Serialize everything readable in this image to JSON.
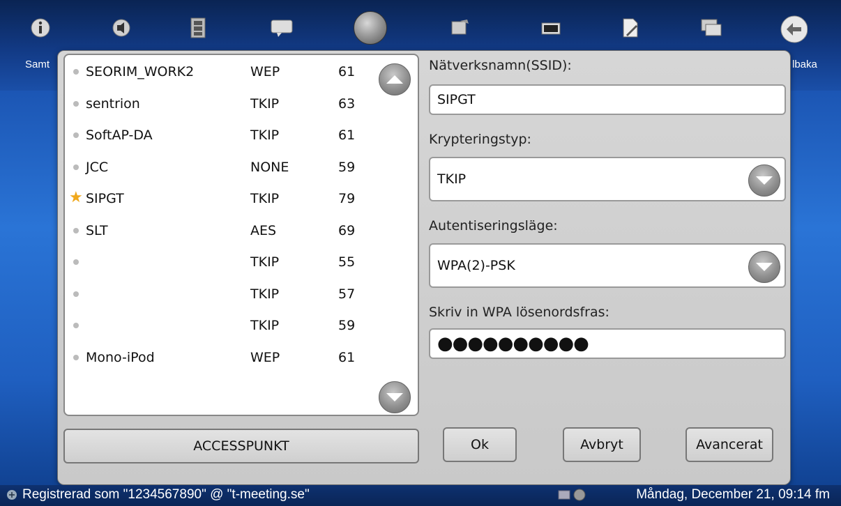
{
  "topbar": {
    "left_label": "Samt",
    "right_label": "lbaka",
    "icons": [
      "info-icon",
      "audio-icon",
      "film-icon",
      "chat-icon",
      "globe-icon",
      "photo-icon",
      "folder-icon",
      "document-icon",
      "windows-icon",
      "back-icon"
    ]
  },
  "network_list": {
    "rows": [
      {
        "name": "SEORIM_WORK2",
        "encryption": "WEP",
        "signal": "61",
        "selected": false
      },
      {
        "name": "sentrion",
        "encryption": "TKIP",
        "signal": "63",
        "selected": false
      },
      {
        "name": "SoftAP-DA",
        "encryption": "TKIP",
        "signal": "61",
        "selected": false
      },
      {
        "name": "JCC",
        "encryption": "NONE",
        "signal": "59",
        "selected": false
      },
      {
        "name": "SIPGT",
        "encryption": "TKIP",
        "signal": "79",
        "selected": true
      },
      {
        "name": "SLT",
        "encryption": "AES",
        "signal": "69",
        "selected": false
      },
      {
        "name": "",
        "encryption": "TKIP",
        "signal": "55",
        "selected": false
      },
      {
        "name": "",
        "encryption": "TKIP",
        "signal": "57",
        "selected": false
      },
      {
        "name": "",
        "encryption": "TKIP",
        "signal": "59",
        "selected": false
      },
      {
        "name": "Mono-iPod",
        "encryption": "WEP",
        "signal": "61",
        "selected": false
      }
    ]
  },
  "form": {
    "ssid_label": "Nätverksnamn(SSID):",
    "ssid_value": "SIPGT",
    "encryption_label": "Krypteringstyp:",
    "encryption_value": "TKIP",
    "auth_label": "Autentiseringsläge:",
    "auth_value": "WPA(2)-PSK",
    "passphrase_label": "Skriv in WPA lösenordsfras:",
    "passphrase_value": "●●●●●●●●●●"
  },
  "buttons": {
    "accesspoint": "ACCESSPUNKT",
    "ok": "Ok",
    "cancel": "Avbryt",
    "advanced": "Avancerat"
  },
  "statusbar": {
    "registered": "Registrerad som \"1234567890\" @ \"t-meeting.se\"",
    "datetime": "Måndag, December 21, 09:14 fm"
  },
  "colors": {
    "star": "#f0a81c",
    "desktop_blue": "#2a74d6"
  }
}
